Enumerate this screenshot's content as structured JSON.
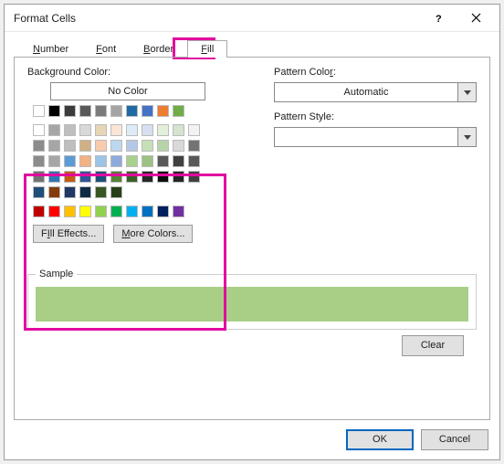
{
  "title": "Format Cells",
  "tabs": [
    {
      "label": "Number",
      "u": "N",
      "rest": "umber"
    },
    {
      "label": "Font",
      "u": "F",
      "rest": "ont"
    },
    {
      "label": "Border",
      "u": "B",
      "rest": "order"
    },
    {
      "label": "Fill",
      "u": "F",
      "rest": "ill"
    }
  ],
  "active_tab": 3,
  "bg_label": "Background Color:",
  "bg_label_u": "C",
  "no_color": "No Color",
  "pattern_color_label": "Pattern Color:",
  "pattern_color_u": "A",
  "pattern_color_value": "Automatic",
  "pattern_style_label": "Pattern Style:",
  "pattern_style_u": "P",
  "fill_effects": "Fill Effects...",
  "fill_effects_u": "I",
  "more_colors": "More Colors...",
  "more_colors_u": "M",
  "sample_label": "Sample",
  "clear_label": "Clear",
  "ok_label": "OK",
  "cancel_label": "Cancel",
  "sample_color": "#a9cf87",
  "palette_top": [
    "#ffffff",
    "#000000",
    "#3b3b3b",
    "#595959",
    "#7b7b7b",
    "#a5a5a5",
    "#1f6aa5",
    "#4472c4",
    "#ed7d31",
    "#70ad47"
  ],
  "palette_theme": [
    "#ffffff",
    "#a6a6a6",
    "#bfbfbf",
    "#d9d9d9",
    "#e7d5b5",
    "#fbe5d6",
    "#deebf7",
    "#d6e0f0",
    "#e2efda",
    "#d5e3cf",
    "#f2f2f2",
    "#8c8c8c",
    "#a6a6a6",
    "#bfbfbf",
    "#d0b084",
    "#f8cbad",
    "#bdd7ee",
    "#b4c7e7",
    "#c5e0b4",
    "#b7d3a8",
    "#d9d9d9",
    "#737373",
    "#8c8c8c",
    "#a6a6a6",
    "#5b9bd5",
    "#f4b183",
    "#9dc3e6",
    "#8faadc",
    "#a9d18e",
    "#9cc283",
    "#595959",
    "#404040",
    "#595959",
    "#737373",
    "#2e75b6",
    "#c55a11",
    "#2f5597",
    "#1f4e79",
    "#548235",
    "#3b5e28",
    "#262626",
    "#0d0d0d",
    "#262626",
    "#404040",
    "#1f4e79",
    "#843c0c",
    "#203864",
    "#0f2a44",
    "#385723",
    "#27401a"
  ],
  "palette_std": [
    "#c00000",
    "#ff0000",
    "#ffc000",
    "#ffff00",
    "#92d050",
    "#00b050",
    "#00b0f0",
    "#0070c0",
    "#002060",
    "#7030a0"
  ]
}
